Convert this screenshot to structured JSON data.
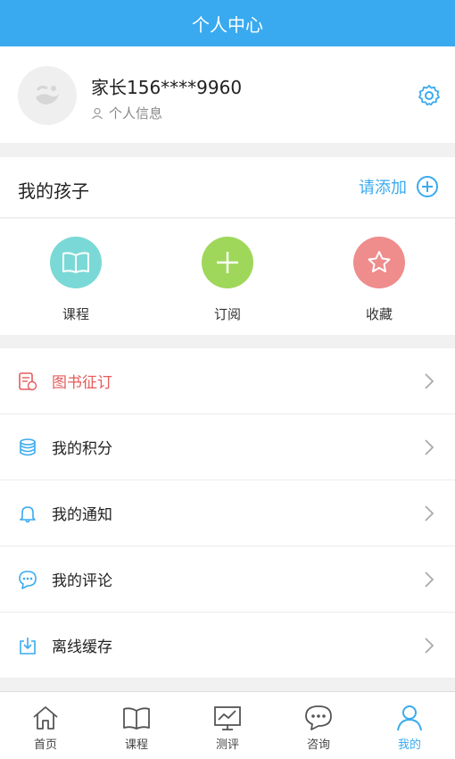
{
  "header": {
    "title": "个人中心"
  },
  "profile": {
    "name": "家长156****9960",
    "info_label": "个人信息"
  },
  "kids": {
    "title": "我的孩子",
    "add_label": "请添加"
  },
  "quick": [
    {
      "label": "课程",
      "color": "#7ad9d6",
      "icon": "book-icon"
    },
    {
      "label": "订阅",
      "color": "#9fd75a",
      "icon": "plus-icon"
    },
    {
      "label": "收藏",
      "color": "#ef8c8c",
      "icon": "star-icon"
    }
  ],
  "menu": [
    {
      "label": "图书征订",
      "icon": "book-order-icon",
      "color": "#e55b5b"
    },
    {
      "label": "我的积分",
      "icon": "coins-icon",
      "color": "#39aaf0"
    },
    {
      "label": "我的通知",
      "icon": "bell-icon",
      "color": "#39aaf0"
    },
    {
      "label": "我的评论",
      "icon": "comment-icon",
      "color": "#39aaf0"
    },
    {
      "label": "离线缓存",
      "icon": "download-icon",
      "color": "#39aaf0"
    }
  ],
  "tabbar": [
    {
      "label": "首页",
      "icon": "home-icon"
    },
    {
      "label": "课程",
      "icon": "book-icon"
    },
    {
      "label": "测评",
      "icon": "chart-icon"
    },
    {
      "label": "咨询",
      "icon": "chat-icon"
    },
    {
      "label": "我的",
      "icon": "user-icon",
      "active": true
    }
  ],
  "colors": {
    "accent": "#39aaf0",
    "danger": "#e55b5b"
  }
}
